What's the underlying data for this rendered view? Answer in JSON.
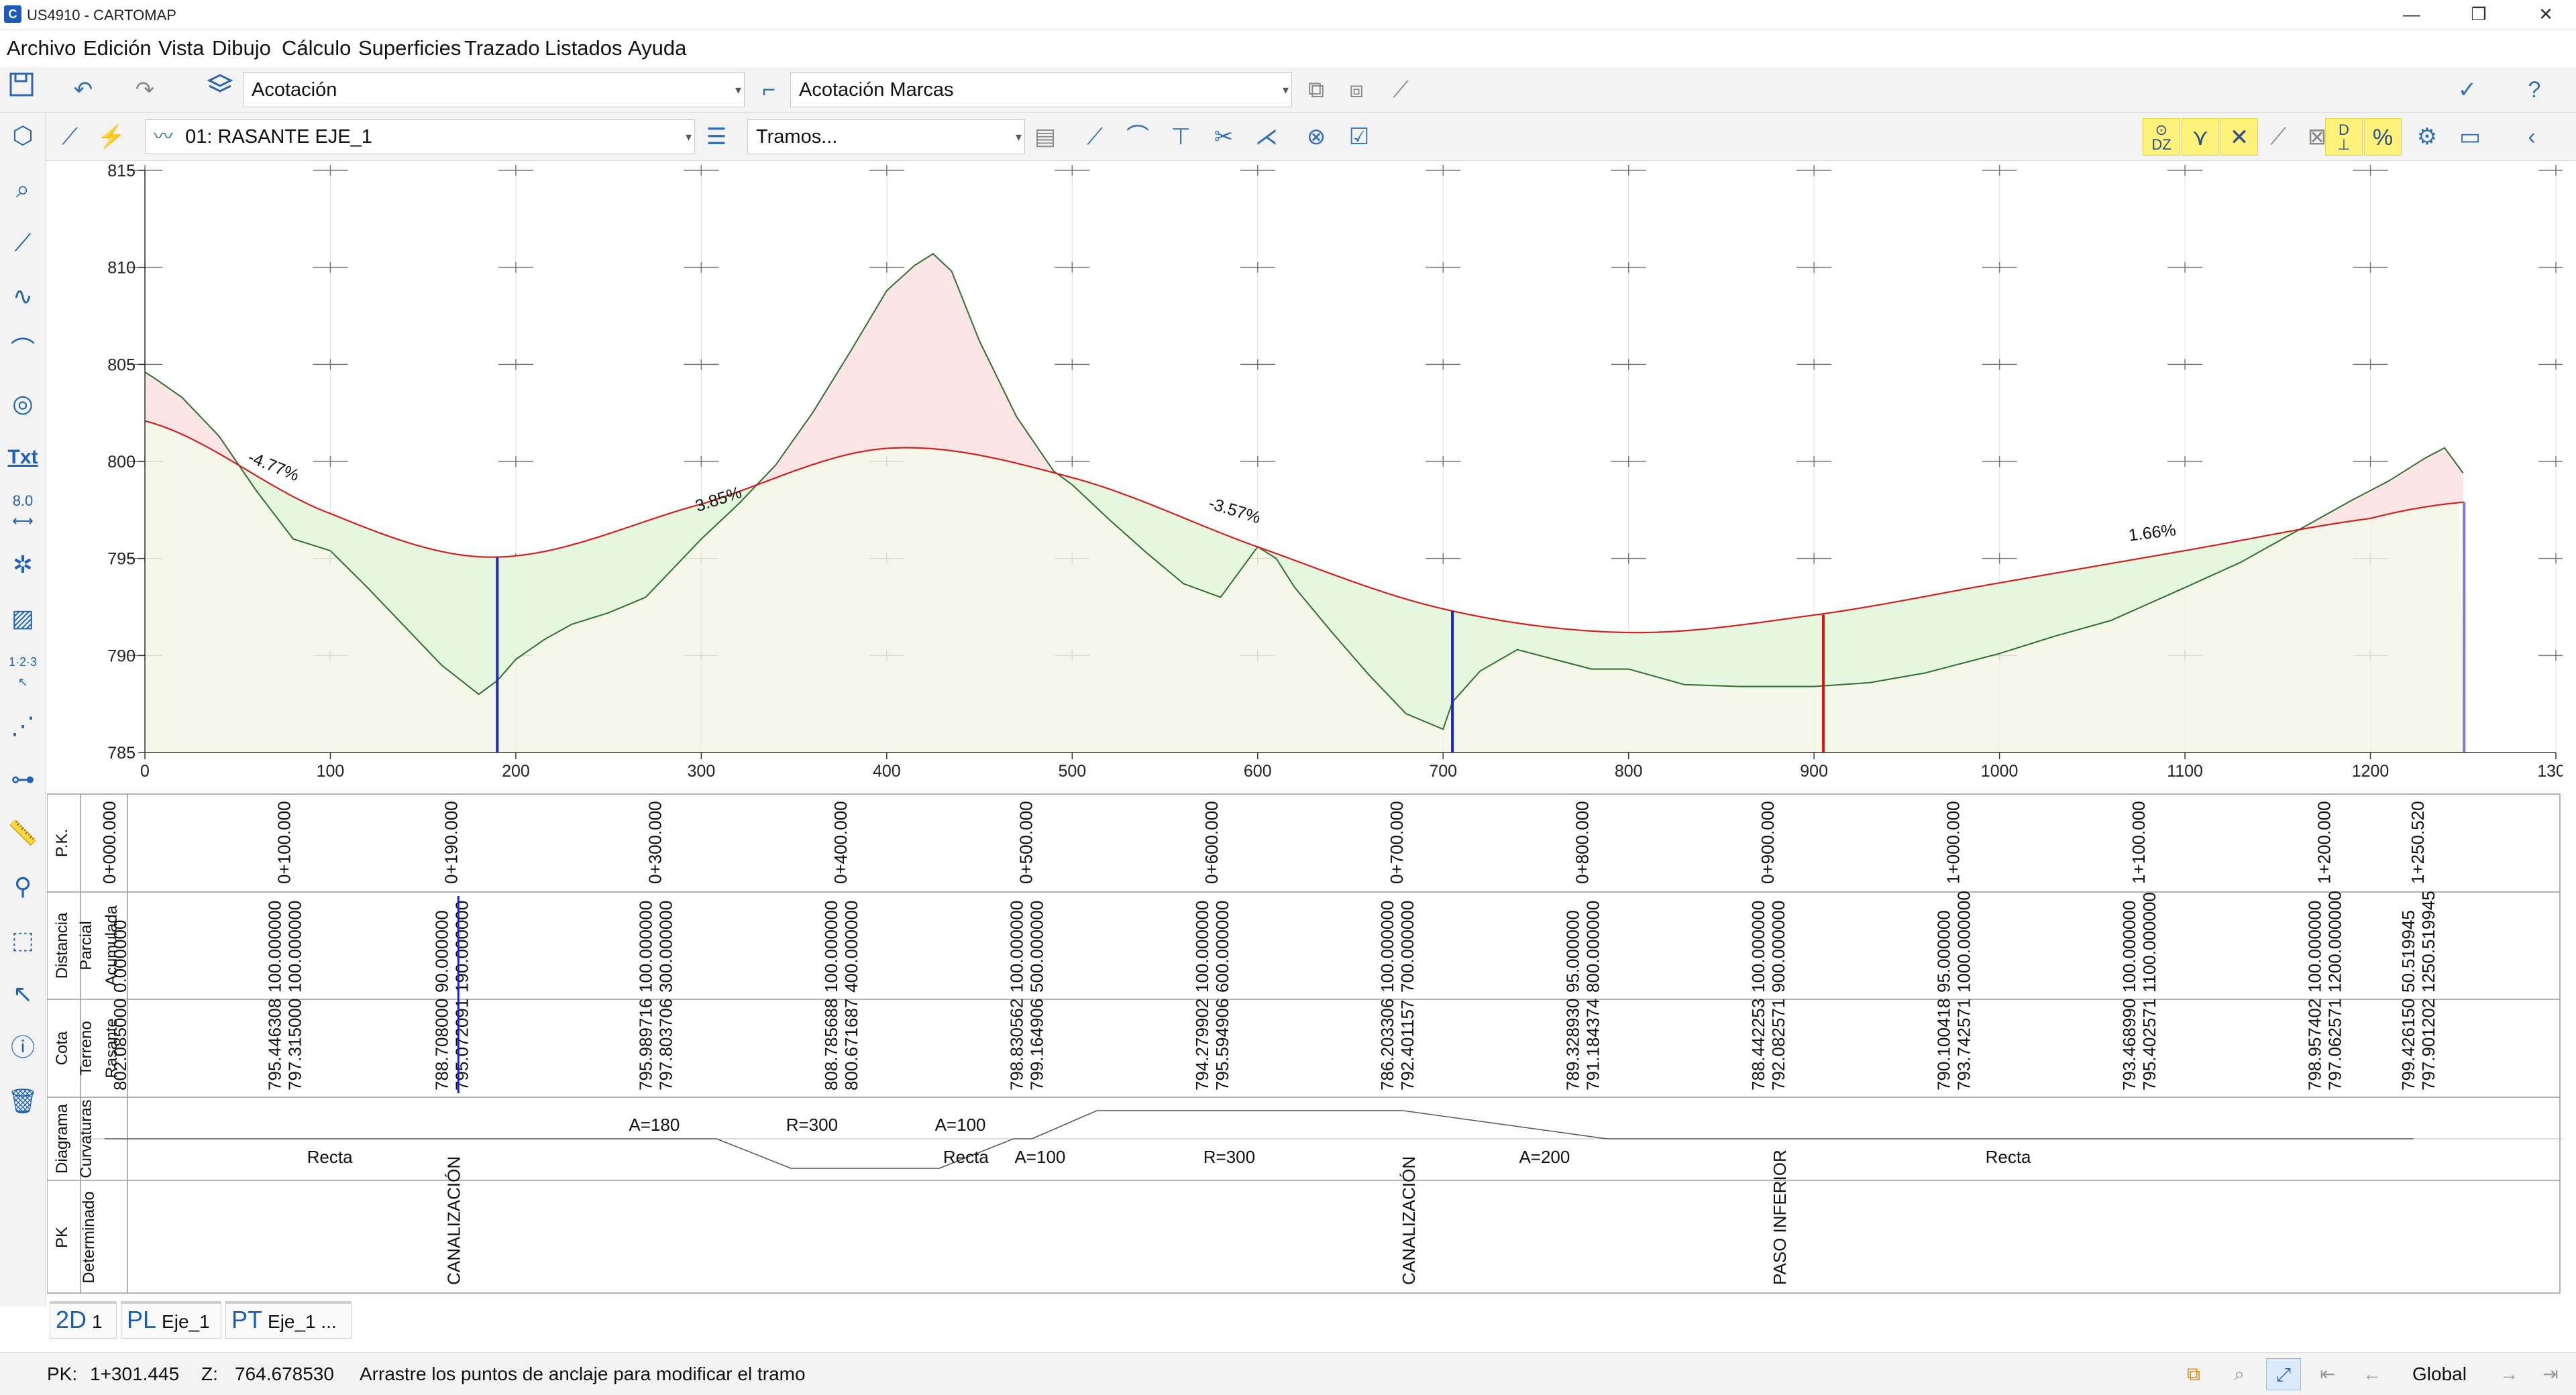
{
  "window": {
    "title": "US4910 - CARTOMAP",
    "logo_letter": "C",
    "minimize": "—",
    "restore": "❐",
    "close": "✕"
  },
  "menu": [
    "Archivo",
    "Edición",
    "Vista",
    "Dibujo",
    "Cálculo",
    "Superficies",
    "Trazado",
    "Listados",
    "Ayuda"
  ],
  "toolbar1": {
    "layer_combo": "Acotación",
    "style_combo": "Acotación Marcas"
  },
  "toolbar2": {
    "alignment_combo": "01: RASANTE EJE_1",
    "mode_combo": "Tramos...",
    "dz_label": "DZ",
    "d_label": "D"
  },
  "left_tools": {
    "txt_label": "Txt",
    "dim_label": "8.0",
    "num_label": "1·2·3"
  },
  "chart_data": {
    "type": "line",
    "title": "",
    "xlim": [
      0,
      1300
    ],
    "ylim": [
      785,
      815
    ],
    "x_ticks": [
      0,
      100,
      200,
      300,
      400,
      500,
      600,
      700,
      800,
      900,
      1000,
      1100,
      1200,
      1300
    ],
    "y_ticks": [
      785,
      790,
      795,
      800,
      805,
      810,
      815
    ],
    "x_tick_labels": [
      "0",
      "100",
      "200",
      "300",
      "400",
      "500",
      "600",
      "700",
      "800",
      "900",
      "1000",
      "1100",
      "1200",
      "1300"
    ],
    "y_tick_labels": [
      "785",
      "790",
      "795",
      "800",
      "805",
      "810",
      "815"
    ],
    "grid": true,
    "series": [
      {
        "role": "terreno",
        "color": "#2f6e2f",
        "x": [
          0,
          5,
          20,
          40,
          60,
          80,
          100,
          120,
          140,
          160,
          180,
          190,
          200,
          215,
          230,
          250,
          270,
          290,
          300,
          320,
          340,
          360,
          380,
          400,
          415,
          425,
          435,
          450,
          470,
          490,
          500,
          520,
          540,
          560,
          580,
          590,
          600,
          610,
          620,
          640,
          660,
          680,
          700,
          705,
          720,
          740,
          760,
          780,
          800,
          830,
          860,
          900,
          930,
          960,
          1000,
          1030,
          1060,
          1100,
          1130,
          1160,
          1190,
          1210,
          1230,
          1240,
          1250
        ],
        "y": [
          804.6,
          804.3,
          803.3,
          801.3,
          798.5,
          796.0,
          795.4,
          793.5,
          791.5,
          789.5,
          788.0,
          788.7,
          789.8,
          790.8,
          791.6,
          792.2,
          793.0,
          795.0,
          796.0,
          797.8,
          799.8,
          802.5,
          805.6,
          808.8,
          810.1,
          810.7,
          809.8,
          806.2,
          802.3,
          799.5,
          798.8,
          797.0,
          795.3,
          793.7,
          793.0,
          794.3,
          795.6,
          795.0,
          793.5,
          791.2,
          789.0,
          787.0,
          786.2,
          787.6,
          789.2,
          790.3,
          789.8,
          789.3,
          789.3,
          788.5,
          788.4,
          788.4,
          788.6,
          789.1,
          790.1,
          791.0,
          791.8,
          793.5,
          794.8,
          796.4,
          798.0,
          799.0,
          800.2,
          800.7,
          799.4
        ]
      },
      {
        "role": "rasante",
        "color": "#d42020",
        "x": [
          0,
          100,
          190,
          300,
          400,
          500,
          600,
          700,
          800,
          900,
          1000,
          1100,
          1200,
          1250.52
        ],
        "y": [
          802.085,
          797.315,
          795.072,
          797.804,
          800.672,
          799.165,
          795.595,
          792.401,
          791.184,
          792.083,
          793.743,
          795.403,
          797.063,
          797.902
        ]
      }
    ],
    "slope_labels": [
      {
        "text": "-4.77%",
        "x": 55,
        "y": 800.0,
        "angle": 22
      },
      {
        "text": "3.85%",
        "x": 298,
        "y": 797.4,
        "angle": -18
      },
      {
        "text": "-3.57%",
        "x": 573,
        "y": 797.6,
        "angle": 17
      },
      {
        "text": "1.66%",
        "x": 1070,
        "y": 795.9,
        "angle": -7
      }
    ],
    "markers": [
      {
        "x": 190,
        "y": 795.072,
        "color": "#1a25c8"
      },
      {
        "x": 705,
        "y": 792.3,
        "color": "#1a25c8"
      },
      {
        "x": 905,
        "y": 792.1,
        "color": "#e01010"
      },
      {
        "x": 1250.52,
        "y": 797.9,
        "color": "#7a7adb"
      }
    ]
  },
  "guitar": {
    "row_labels": {
      "pk": "P.K.",
      "distancia": "Distancia",
      "parcial": "Parcial",
      "acumulada": "Acumulada",
      "cota": "Cota",
      "terreno": "Terreno",
      "rasante": "Rasante",
      "diagrama": "Diagrama",
      "curvaturas": "Curvaturas",
      "pk2": "PK",
      "determinado": "Determinado"
    },
    "stations": [
      {
        "x": 0,
        "pk": "0+000.000",
        "parcial": "",
        "acumulada": "0.000000",
        "terreno": "",
        "rasante": "802.085000"
      },
      {
        "x": 100,
        "pk": "0+100.000",
        "parcial": "100.000000",
        "acumulada": "100.000000",
        "terreno": "795.446308",
        "rasante": "797.315000"
      },
      {
        "x": 190,
        "pk": "0+190.000",
        "parcial": "90.000000",
        "acumulada": "190.000000",
        "terreno": "788.708000",
        "rasante": "795.072091"
      },
      {
        "x": 300,
        "pk": "0+300.000",
        "parcial": "100.000000",
        "acumulada": "300.000000",
        "terreno": "795.989716",
        "rasante": "797.803706"
      },
      {
        "x": 400,
        "pk": "0+400.000",
        "parcial": "100.000000",
        "acumulada": "400.000000",
        "terreno": "808.785688",
        "rasante": "800.671687"
      },
      {
        "x": 500,
        "pk": "0+500.000",
        "parcial": "100.000000",
        "acumulada": "500.000000",
        "terreno": "798.830562",
        "rasante": "799.164906"
      },
      {
        "x": 600,
        "pk": "0+600.000",
        "parcial": "100.000000",
        "acumulada": "600.000000",
        "terreno": "794.279902",
        "rasante": "795.594906"
      },
      {
        "x": 700,
        "pk": "0+700.000",
        "parcial": "100.000000",
        "acumulada": "700.000000",
        "terreno": "786.203306",
        "rasante": "792.401157"
      },
      {
        "x": 800,
        "pk": "0+800.000",
        "parcial": "95.000000",
        "acumulada": "800.000000",
        "terreno": "789.328930",
        "rasante": "791.184374"
      },
      {
        "x": 900,
        "pk": "0+900.000",
        "parcial": "100.000000",
        "acumulada": "900.000000",
        "terreno": "788.442253",
        "rasante": "792.082571"
      },
      {
        "x": 1000,
        "pk": "1+000.000",
        "parcial": "95.000000",
        "acumulada": "1000.000000",
        "terreno": "790.100418",
        "rasante": "793.742571"
      },
      {
        "x": 1100,
        "pk": "1+100.000",
        "parcial": "100.000000",
        "acumulada": "1100.000000",
        "terreno": "793.468990",
        "rasante": "795.402571"
      },
      {
        "x": 1200,
        "pk": "1+200.000",
        "parcial": "100.000000",
        "acumulada": "1200.000000",
        "terreno": "798.957402",
        "rasante": "797.062571"
      },
      {
        "x": 1250.52,
        "pk": "1+250.520",
        "parcial": "50.519945",
        "acumulada": "1250.519945",
        "terreno": "799.426150",
        "rasante": "797.901202"
      }
    ],
    "curvature_labels": [
      {
        "text": "A=180",
        "x": 300,
        "row": "top"
      },
      {
        "text": "R=300",
        "x": 385,
        "row": "top"
      },
      {
        "text": "A=100",
        "x": 465,
        "row": "top"
      },
      {
        "text": "Recta",
        "x": 125,
        "row": "bottom"
      },
      {
        "text": "Recta",
        "x": 468,
        "row": "bottom"
      },
      {
        "text": "A=100",
        "x": 508,
        "row": "bottom"
      },
      {
        "text": "R=300",
        "x": 610,
        "row": "bottom"
      },
      {
        "text": "A=200",
        "x": 780,
        "row": "bottom"
      },
      {
        "text": "Recta",
        "x": 1030,
        "row": "bottom"
      }
    ],
    "determined": [
      {
        "x": 190,
        "text": "CANALIZACIÓN",
        "color": "#1a25c8"
      },
      {
        "x": 705,
        "text": "CANALIZACIÓN",
        "color": "#1a25c8"
      },
      {
        "x": 905,
        "text": "PASO INFERIOR",
        "color": "#e01010"
      }
    ]
  },
  "tabs": [
    {
      "short": "2D",
      "label": "1",
      "color": "#f0a020"
    },
    {
      "short": "PL",
      "label": "Eje_1",
      "color": "#e02020"
    },
    {
      "short": "PT",
      "label": "Eje_1 ...",
      "color": "#20a040"
    }
  ],
  "status": {
    "pk_label": "PK:",
    "pk_value": "1+301.445",
    "z_label": "Z:",
    "z_value": "764.678530",
    "message": "Arrastre los puntos de anclaje para modificar el tramo",
    "scope": "Global"
  },
  "colors": {
    "accent": "#1f63b8",
    "cut_fill": "#fde5e5",
    "fill_fill": "#e6f7df"
  }
}
